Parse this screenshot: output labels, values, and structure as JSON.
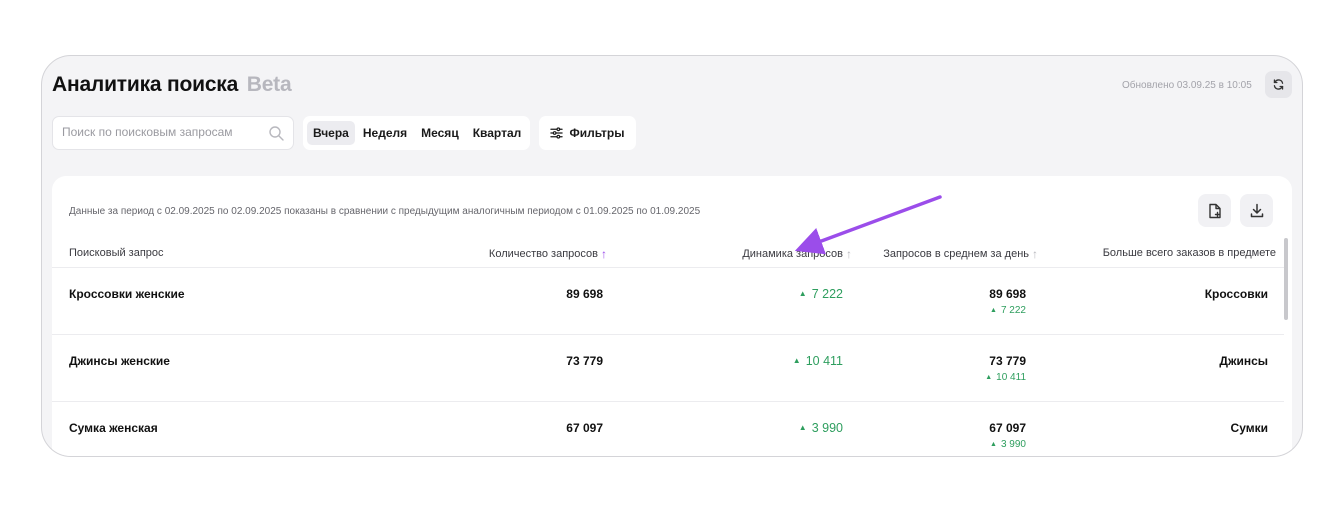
{
  "header": {
    "title": "Аналитика поиска",
    "beta": "Beta",
    "updated": "Обновлено 03.09.25 в 10:05"
  },
  "search": {
    "placeholder": "Поиск по поисковым запросам",
    "value": ""
  },
  "periods": [
    {
      "label": "Вчера",
      "active": true
    },
    {
      "label": "Неделя",
      "active": false
    },
    {
      "label": "Месяц",
      "active": false
    },
    {
      "label": "Квартал",
      "active": false
    }
  ],
  "filters_label": "Фильтры",
  "panel": {
    "period_note": "Данные за период с 02.09.2025 по 02.09.2025 показаны в сравнении с предыдущим аналогичным периодом с 01.09.2025 по 01.09.2025"
  },
  "table": {
    "columns": {
      "query": "Поисковый запрос",
      "count": "Количество запросов",
      "dynamics": "Динамика запросов",
      "avg": "Запросов в среднем за день",
      "subject": "Больше всего заказов в предмете"
    },
    "sort_arrow": "↑",
    "rows": [
      {
        "query": "Кроссовки женские",
        "count": "89 698",
        "dynamics": "7 222",
        "avg": "89 698",
        "avg_dyn": "7 222",
        "subject": "Кроссовки"
      },
      {
        "query": "Джинсы женские",
        "count": "73 779",
        "dynamics": "10 411",
        "avg": "73 779",
        "avg_dyn": "10 411",
        "subject": "Джинсы"
      },
      {
        "query": "Сумка женская",
        "count": "67 097",
        "dynamics": "3 990",
        "avg": "67 097",
        "avg_dyn": "3 990",
        "subject": "Сумки"
      }
    ]
  },
  "colors": {
    "accent": "#9b4dea",
    "positive": "#2e9e5e",
    "annotation_arrow": "#9b4dea"
  },
  "icons": [
    "search-icon",
    "refresh-icon",
    "filter-icon",
    "report-icon",
    "download-icon",
    "sort-arrow-icon"
  ]
}
